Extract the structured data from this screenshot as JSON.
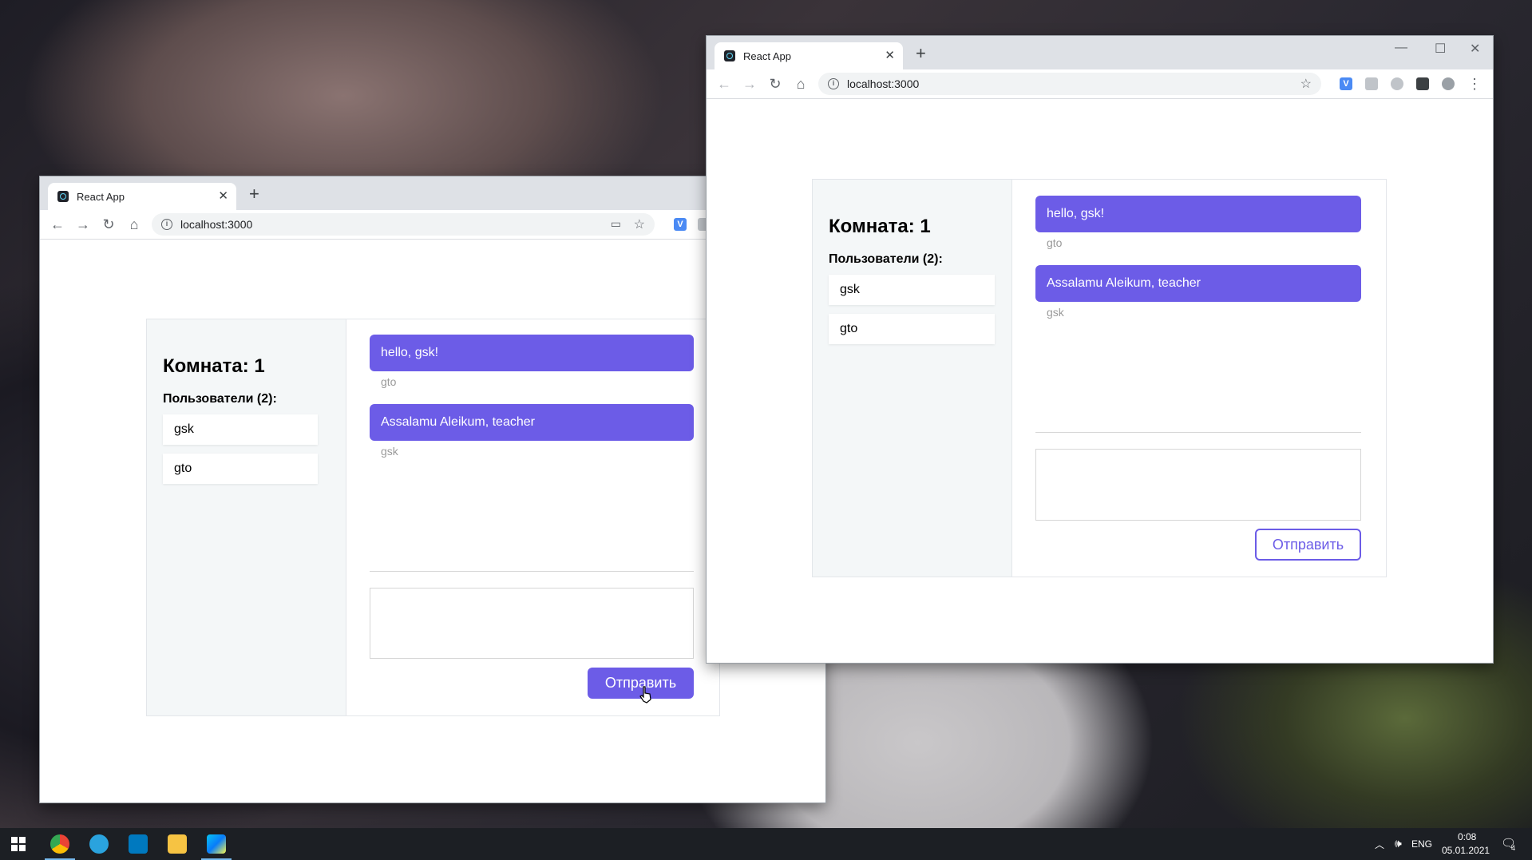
{
  "browser_tab_title": "React App",
  "url": "localhost:3000",
  "chat": {
    "room_title": "Комната: 1",
    "users_heading": "Пользователи (2):",
    "users": [
      "gsk",
      "gto"
    ],
    "messages": [
      {
        "text": "hello, gsk!",
        "author": "gto"
      },
      {
        "text": "Assalamu Aleikum, teacher",
        "author": "gsk"
      }
    ],
    "message_input_value": "",
    "send_label": "Отправить"
  },
  "taskbar": {
    "language": "ENG",
    "time": "0:08",
    "date": "05.01.2021",
    "notifications_count": "4"
  },
  "colors": {
    "accent": "#6c5ce7",
    "sidebar_bg": "#f4f7f8",
    "taskbar": "#1c1f24"
  }
}
